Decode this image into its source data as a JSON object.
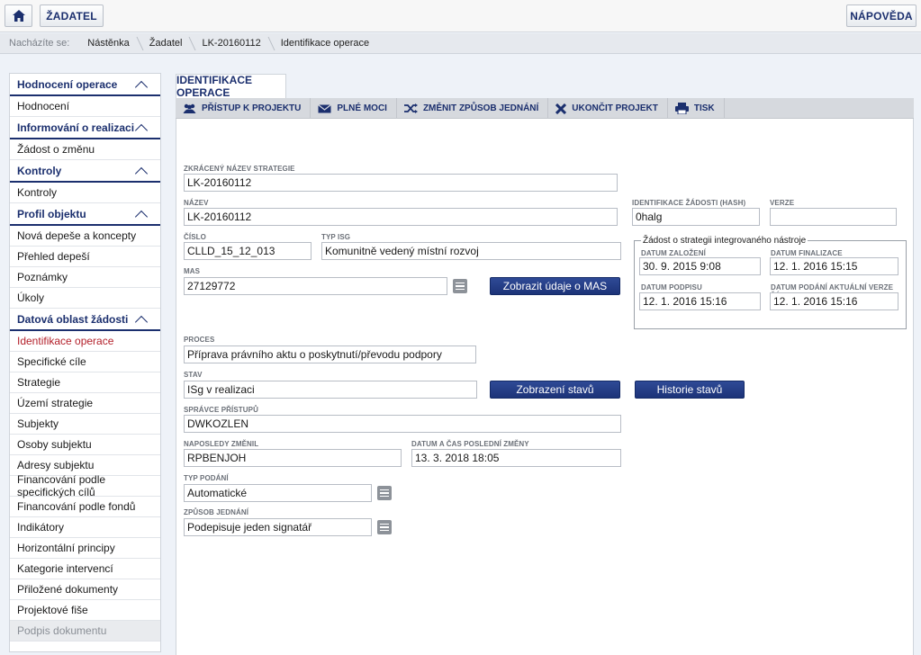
{
  "topbar": {
    "user_label": "ŽADATEL",
    "help_label": "NÁPOVĚDA"
  },
  "breadcrumb": {
    "lead": "Nacházíte se:",
    "items": [
      "Nástěnka",
      "Žadatel",
      "LK-20160112",
      "Identifikace operace"
    ]
  },
  "sidebar": {
    "sections": [
      {
        "title": "Hodnocení operace",
        "items": [
          "Hodnocení"
        ]
      },
      {
        "title": "Informování o realizaci",
        "items": [
          "Žádost o změnu"
        ]
      },
      {
        "title": "Kontroly",
        "items": [
          "Kontroly"
        ]
      },
      {
        "title": "Profil objektu",
        "items": [
          "Nová depeše a koncepty",
          "Přehled depeší",
          "Poznámky",
          "Úkoly"
        ]
      },
      {
        "title": "Datová oblast žádosti",
        "items": [
          "Identifikace operace",
          "Specifické cíle",
          "Strategie",
          "Území strategie",
          "Subjekty",
          "Osoby subjektu",
          "Adresy subjektu",
          "Financování podle specifických cílů",
          "Financování podle fondů",
          "Indikátory",
          "Horizontální principy",
          "Kategorie intervencí",
          "Přiložené dokumenty",
          "Projektové fiše",
          "Podpis dokumentu"
        ]
      }
    ],
    "active_item": "Identifikace operace",
    "disabled_item": "Podpis dokumentu"
  },
  "tab": {
    "label": "IDENTIFIKACE OPERACE"
  },
  "toolbar": {
    "items": [
      {
        "label": "PŘÍSTUP K PROJEKTU",
        "icon": "users-icon"
      },
      {
        "label": "PLNÉ MOCI",
        "icon": "envelope-icon"
      },
      {
        "label": "ZMĚNIT ZPŮSOB JEDNÁNÍ",
        "icon": "shuffle-icon"
      },
      {
        "label": "UKONČIT PROJEKT",
        "icon": "close-icon"
      },
      {
        "label": "TISK",
        "icon": "printer-icon"
      }
    ]
  },
  "form": {
    "short_name": {
      "label": "ZKRÁCENÝ NÁZEV STRATEGIE",
      "value": "LK-20160112"
    },
    "name": {
      "label": "NÁZEV",
      "value": "LK-20160112"
    },
    "hash": {
      "label": "IDENTIFIKACE ŽÁDOSTI (HASH)",
      "value": "0halg"
    },
    "version": {
      "label": "VERZE",
      "value": ""
    },
    "number": {
      "label": "ČÍSLO",
      "value": "CLLD_15_12_013"
    },
    "isg_type": {
      "label": "TYP ISG",
      "value": "Komunitně vedený místní rozvoj"
    },
    "mas": {
      "label": "MAS",
      "value": "27129772"
    },
    "mas_button": "Zobrazit údaje o MAS",
    "isg_group": {
      "legend": "Žádost o strategii integrovaného nástroje",
      "created": {
        "label": "DATUM ZALOŽENÍ",
        "value": "30. 9. 2015 9:08"
      },
      "finalized": {
        "label": "DATUM FINALIZACE",
        "value": "12. 1. 2016 15:15"
      },
      "signed": {
        "label": "DATUM PODPISU",
        "value": "12. 1. 2016 15:16"
      },
      "submitted": {
        "label": "DATUM PODÁNÍ AKTUÁLNÍ VERZE ŽÁDOSTI",
        "value": "12. 1. 2016 15:16"
      }
    },
    "process": {
      "label": "PROCES",
      "value": "Příprava právního aktu o poskytnutí/převodu podpory"
    },
    "state": {
      "label": "STAV",
      "value": "ISg v realizaci"
    },
    "states_button": "Zobrazení stavů",
    "history_button": "Historie stavů",
    "access_admin": {
      "label": "SPRÁVCE PŘÍSTUPŮ",
      "value": "DWKOZLEN"
    },
    "last_changed_by": {
      "label": "NAPOSLEDY ZMĚNIL",
      "value": "RPBENJOH"
    },
    "last_changed_at": {
      "label": "DATUM A ČAS POSLEDNÍ ZMĚNY",
      "value": "13. 3. 2018 18:05"
    },
    "submission_type": {
      "label": "TYP PODÁNÍ",
      "value": "Automatické"
    },
    "acting_method": {
      "label": "ZPŮSOB JEDNÁNÍ",
      "value": "Podepisuje jeden signatář"
    }
  },
  "colors": {
    "brand_navy": "#1b2f6e",
    "active_red": "#b3202a",
    "button_blue": "#243d88"
  }
}
